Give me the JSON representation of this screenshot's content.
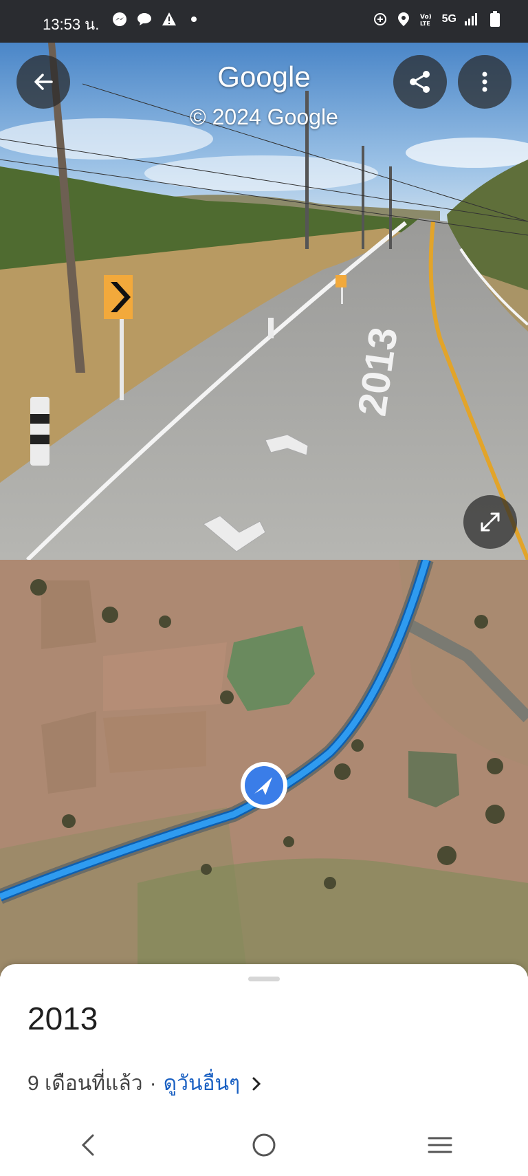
{
  "status_bar": {
    "time": "13:53 น.",
    "network": "5G"
  },
  "street_view": {
    "title": "Google",
    "copyright": "© 2024 Google",
    "road_marking": "2013"
  },
  "bottom_sheet": {
    "title": "2013",
    "age": "9 เดือนที่แล้ว",
    "separator": "·",
    "more_dates_link": "ดูวันอื่นๆ"
  },
  "colors": {
    "route": "#2f9bf0",
    "location_puck": "#3a7de8",
    "link": "#1a60c2"
  }
}
